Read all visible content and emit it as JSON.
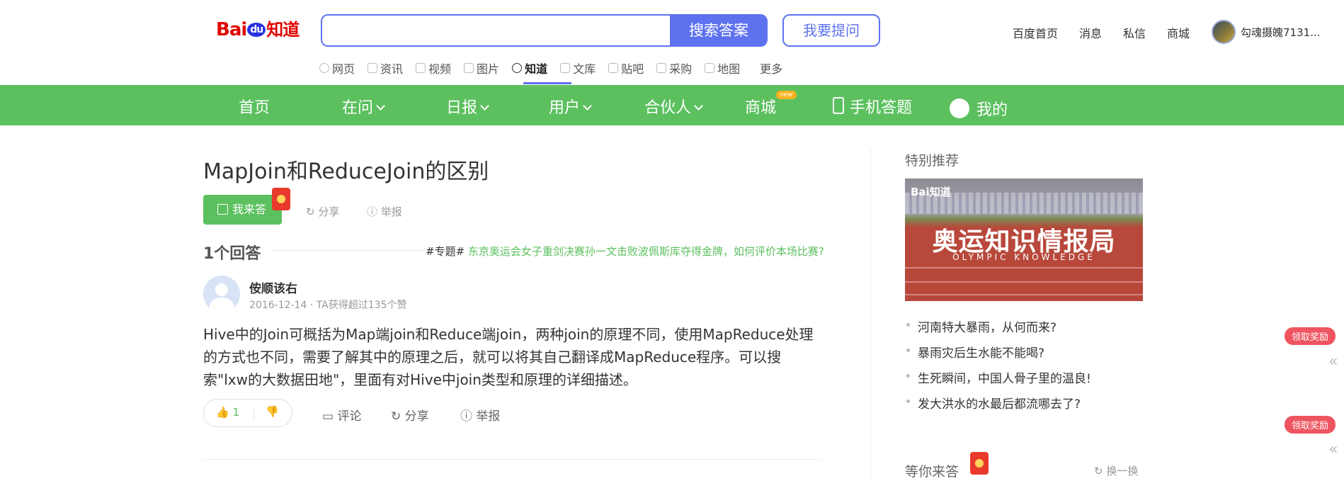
{
  "header": {
    "logo_bai": "Bai",
    "logo_du": "du",
    "logo_zhidao": "知道",
    "search_value": "",
    "search_button": "搜索答案",
    "ask_button": "我要提问",
    "links": [
      "百度首页",
      "消息",
      "私信",
      "商城"
    ],
    "username": "勾魂摄魄7131..."
  },
  "channels": [
    {
      "label": "网页",
      "icon": "search-icon"
    },
    {
      "label": "资讯",
      "icon": "news-icon"
    },
    {
      "label": "视频",
      "icon": "video-icon"
    },
    {
      "label": "图片",
      "icon": "image-icon"
    },
    {
      "label": "知道",
      "icon": "question-icon",
      "active": true
    },
    {
      "label": "文库",
      "icon": "doc-icon"
    },
    {
      "label": "贴吧",
      "icon": "tieba-icon"
    },
    {
      "label": "采购",
      "icon": "shop-icon"
    },
    {
      "label": "地图",
      "icon": "map-icon"
    },
    {
      "label": "更多"
    }
  ],
  "nav": {
    "home": "首页",
    "zaiwen": "在问",
    "ribao": "日报",
    "user": "用户",
    "partner": "合伙人",
    "mall": "商城",
    "mall_badge": "new",
    "mobile": "手机答题",
    "mine": "我的",
    "bar_color": "#5cc05f"
  },
  "question": {
    "title": "MapJoin和ReduceJoin的区别",
    "answer_button": "我来答",
    "share": "分享",
    "report": "举报"
  },
  "answers": {
    "count_label": "1个回答",
    "topic_prefix": "#专题#",
    "topic_link": "东京奥运会女子重剑决赛孙一文击败波佩斯库夺得金牌，如何评价本场比赛?",
    "answer": {
      "author": "侒顺该右",
      "meta": "2016-12-14 · TA获得超过135个赞",
      "text": "Hive中的Join可概括为Map端join和Reduce端join，两种join的原理不同，使用MapReduce处理的方式也不同，需要了解其中的原理之后，就可以将其自己翻译成MapReduce程序。可以搜索\"lxw的大数据田地\"，里面有对Hive中join类型和原理的详细描述。",
      "likes": "1",
      "comment": "评论",
      "share": "分享",
      "report": "举报"
    }
  },
  "sidebar": {
    "special_title": "特别推荐",
    "banner_logo": "Bai知道",
    "banner_title": "奥运知识情报局",
    "banner_sub": "OLYMPIC  KNOWLEDGE",
    "recommendations": [
      "河南特大暴雨，从何而来?",
      "暴雨灾后生水能不能喝?",
      "生死瞬间，中国人骨子里的温良!",
      "发大洪水的水最后都流哪去了?"
    ],
    "waiting_title": "等你来答",
    "refresh": "换一换"
  },
  "floating": {
    "reward": "领取奖励",
    "reward2": "领取奖励"
  },
  "colors": {
    "accent_blue": "#5e72f0",
    "green": "#5cc05f",
    "red": "#e10601"
  }
}
